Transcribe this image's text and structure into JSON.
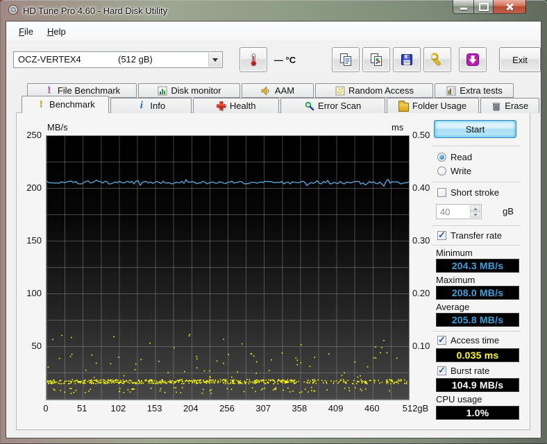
{
  "window": {
    "title": "HD Tune Pro 4.60 - Hard Disk Utility"
  },
  "menu": {
    "file_label": "File",
    "help_label": "Help"
  },
  "toolbar": {
    "drive_name": "OCZ-VERTEX4",
    "drive_size": "(512 gB)",
    "temperature_value": "—",
    "temperature_unit": "°C",
    "exit_label": "Exit"
  },
  "icons": {
    "app-icon": "hard-disk-platter",
    "thermometer-icon": "thermometer",
    "copy-report-icon": "copy-text-pages",
    "copy-screenshot-icon": "copy-image-pages",
    "save-icon": "floppy-disk",
    "options-icon": "wrench",
    "scroll-icon": "magenta-down-arrow",
    "minimize-icon": "minimize-bar",
    "maximize-icon": "maximize-square",
    "close-icon": "close-x",
    "benchmark-icon": "yellow-exclamation",
    "file-benchmark-icon": "purple-exclamation",
    "disk-monitor-icon": "bar-chart",
    "aam-icon": "speaker",
    "random-access-icon": "scatter-dots",
    "extra-tests-icon": "chart-table",
    "info-icon": "blue-i",
    "health-icon": "red-cross",
    "error-scan-icon": "magnifier",
    "folder-usage-icon": "yellow-folder",
    "erase-icon": "trash-can"
  },
  "tabs": {
    "row1": [
      {
        "label": "File Benchmark"
      },
      {
        "label": "Disk monitor"
      },
      {
        "label": "AAM"
      },
      {
        "label": "Random Access"
      },
      {
        "label": "Extra tests"
      }
    ],
    "row2": [
      {
        "label": "Benchmark",
        "active": true
      },
      {
        "label": "Info"
      },
      {
        "label": "Health"
      },
      {
        "label": "Error Scan"
      },
      {
        "label": "Folder Usage"
      },
      {
        "label": "Erase"
      }
    ]
  },
  "chart_data": {
    "type": "line+scatter",
    "title": "",
    "x_axis": {
      "unit": "gB",
      "min": 0,
      "max": 512,
      "tick_labels": [
        "0",
        "51",
        "102",
        "153",
        "204",
        "256",
        "307",
        "358",
        "409",
        "460",
        "512gB"
      ]
    },
    "y_left": {
      "label": "MB/s",
      "min": 0,
      "max": 250,
      "tick_labels": [
        "250",
        "200",
        "150",
        "100",
        "50"
      ]
    },
    "y_right": {
      "label": "ms",
      "min": 0,
      "max": 0.5,
      "tick_labels": [
        "0.50",
        "0.40",
        "0.30",
        "0.20",
        "0.10"
      ]
    },
    "grid": {
      "x_divisions": 20,
      "y_divisions": 10,
      "grid_on": true
    },
    "series": [
      {
        "name": "transfer_rate",
        "type": "line",
        "color": "#55b0e4",
        "unit": "MB/s",
        "min": 204.3,
        "max": 208.0,
        "avg": 205.8
      },
      {
        "name": "access_time",
        "type": "scatter",
        "color": "#ffff00",
        "unit": "ms",
        "typical": 0.035,
        "scatter_range": [
          0.03,
          0.13
        ]
      }
    ],
    "seed": 9
  },
  "panel": {
    "start_label": "Start",
    "read_label": "Read",
    "write_label": "Write",
    "short_stroke_label": "Short stroke",
    "short_stroke_value": "40",
    "short_stroke_unit": "gB",
    "transfer_rate_label": "Transfer rate",
    "minimum_label": "Minimum",
    "minimum_value": "204.3 MB/s",
    "maximum_label": "Maximum",
    "maximum_value": "208.0 MB/s",
    "average_label": "Average",
    "average_value": "205.8 MB/s",
    "access_time_label": "Access time",
    "access_time_value": "0.035 ms",
    "burst_rate_label": "Burst rate",
    "burst_rate_value": "104.9 MB/s",
    "cpu_usage_label": "CPU usage",
    "cpu_usage_value": "1.0%"
  },
  "colors": {
    "value_blue": "#35a3e0",
    "value_yellow": "#ffff00",
    "value_white": "#ffffff",
    "line_blue": "#55b0e4",
    "dot_yellow": "#ffff00"
  }
}
